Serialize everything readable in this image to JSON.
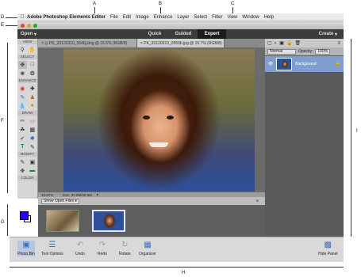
{
  "callouts": {
    "A": "A",
    "B": "B",
    "C": "C",
    "D": "D",
    "E": "E",
    "F": "F",
    "G": "G",
    "H": "H",
    "I": "I"
  },
  "menubar": {
    "app_name": "Adobe Photoshop Elements Editor",
    "items": [
      "File",
      "Edit",
      "Image",
      "Enhance",
      "Layer",
      "Select",
      "Filter",
      "View",
      "Window",
      "Help"
    ]
  },
  "modebar": {
    "open": "Open",
    "quick": "Quick",
    "guided": "Guided",
    "expert": "Expert",
    "create": "Create"
  },
  "tools": {
    "view": "VIEW",
    "select": "SELECT",
    "enhance": "ENHANCE",
    "draw": "DRAW",
    "modify": "MODIFY",
    "color": "COLOR"
  },
  "tabs": [
    {
      "label": "× ◎ PK_20120310_0646j.dng @ 16.5% (RGB/8)"
    },
    {
      "label": "× PK_20120310_0559b.jpg @ 16.7% (RGB/8)"
    }
  ],
  "status": {
    "zoom": "16.67%",
    "doc": "Doc: 30.9M/35.5M"
  },
  "bin": {
    "dropdown": "Show Open Files"
  },
  "layers": {
    "blend": "Normal",
    "opacity_label": "Opacity:",
    "opacity": "100%",
    "layer_name": "Background"
  },
  "bottom": {
    "photo_bin": "Photo Bin",
    "tool_options": "Tool Options",
    "undo": "Undo",
    "redo": "Redo",
    "rotate": "Rotate",
    "organizer": "Organizer",
    "hide_panel": "Hide Panel"
  }
}
